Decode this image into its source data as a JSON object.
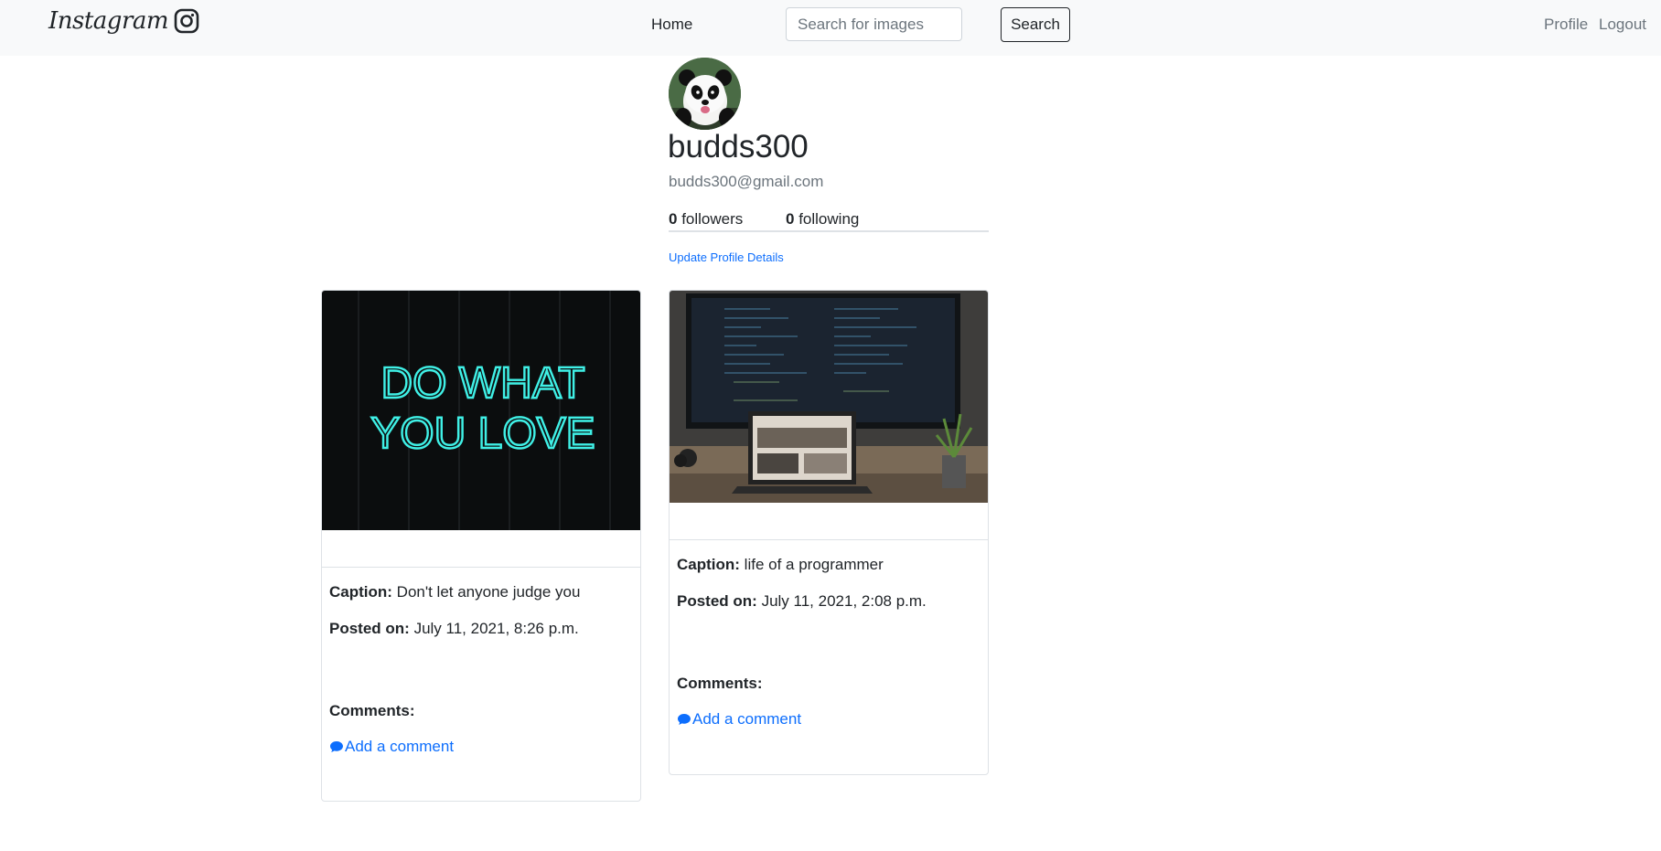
{
  "navbar": {
    "brand": "Instagram",
    "home": "Home",
    "search_placeholder": "Search for images",
    "search_button": "Search",
    "profile": "Profile",
    "logout": "Logout"
  },
  "profile": {
    "username": "budds300",
    "email": "budds300@gmail.com",
    "followers_count": "0",
    "followers_label": "followers",
    "following_count": "0",
    "following_label": "following",
    "update_link": "Update Profile Details"
  },
  "posts": [
    {
      "image_text_line1": "DO WHAT",
      "image_text_line2": "YOU LOVE",
      "caption_label": "Caption:",
      "caption": "Don't let anyone judge you",
      "posted_label": "Posted on:",
      "posted": "July 11, 2021, 8:26 p.m.",
      "comments_label": "Comments:",
      "add_comment": "Add a comment"
    },
    {
      "caption_label": "Caption:",
      "caption": "life of a programmer",
      "posted_label": "Posted on:",
      "posted": "July 11, 2021, 2:08 p.m.",
      "comments_label": "Comments:",
      "add_comment": "Add a comment"
    }
  ],
  "colors": {
    "link": "#0d6efd",
    "neon": "#3ff0e6",
    "navbar_bg": "#f8f9fa"
  },
  "icons": {
    "brand_icon": "instagram-icon",
    "comment_icon": "comment-icon"
  }
}
